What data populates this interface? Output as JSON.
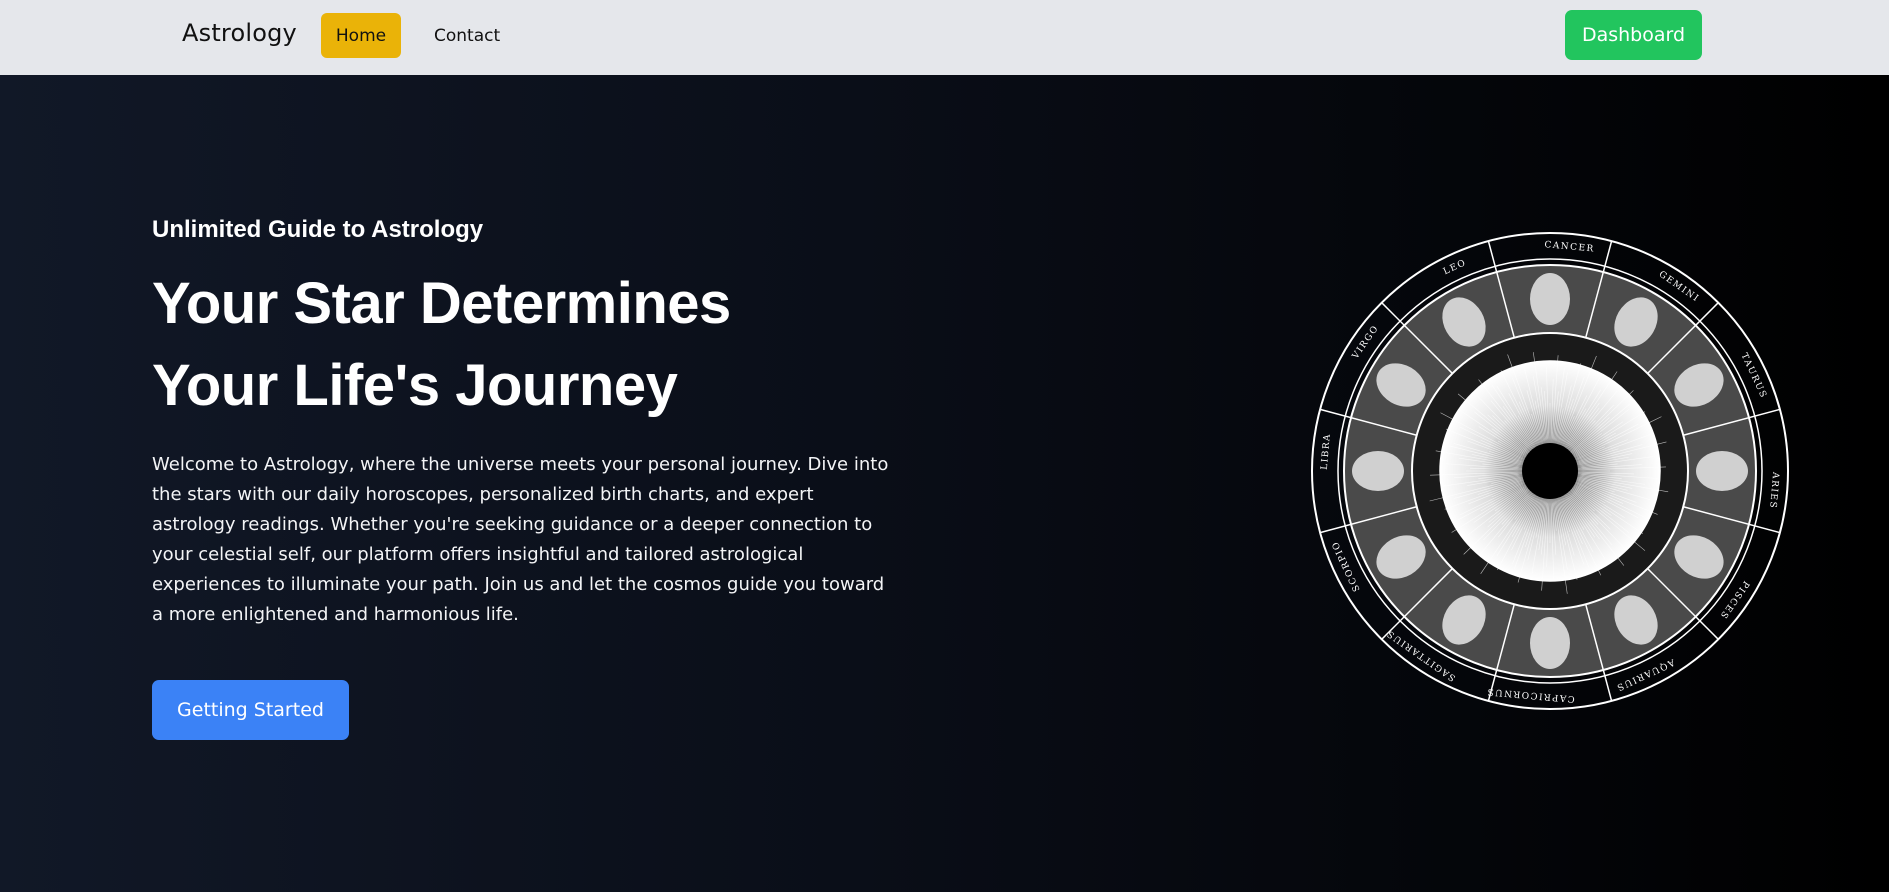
{
  "nav": {
    "brand": "Astrology",
    "items": [
      {
        "label": "Home",
        "active": true
      },
      {
        "label": "Contact",
        "active": false
      }
    ],
    "dashboard_label": "Dashboard"
  },
  "hero": {
    "eyebrow": "Unlimited Guide to Astrology",
    "headline_line1": "Your Star Determines",
    "headline_line2": "Your Life's Journey",
    "description": "Welcome to Astrology, where the universe meets your personal journey. Dive into the stars with our daily horoscopes, personalized birth charts, and expert astrology readings. Whether you're seeking guidance or a deeper connection to your celestial self, our platform offers insightful and tailored astrological experiences to illuminate your path. Join us and let the cosmos guide you toward a more enlightened and harmonious life.",
    "cta_label": "Getting Started"
  },
  "zodiac": {
    "signs": [
      "CANCER",
      "GEMINI",
      "TAURUS",
      "ARIES",
      "PISCES",
      "AQUARIUS",
      "CAPRICORNUS",
      "SAGITTARIUS",
      "SCORPIO",
      "LIBRA",
      "VIRGO",
      "LEO"
    ]
  },
  "colors": {
    "nav_bg": "#e5e7eb",
    "active_nav": "#eab308",
    "dashboard": "#22c55e",
    "cta": "#3b82f6",
    "hero_bg_start": "#111827",
    "hero_bg_end": "#000000"
  }
}
